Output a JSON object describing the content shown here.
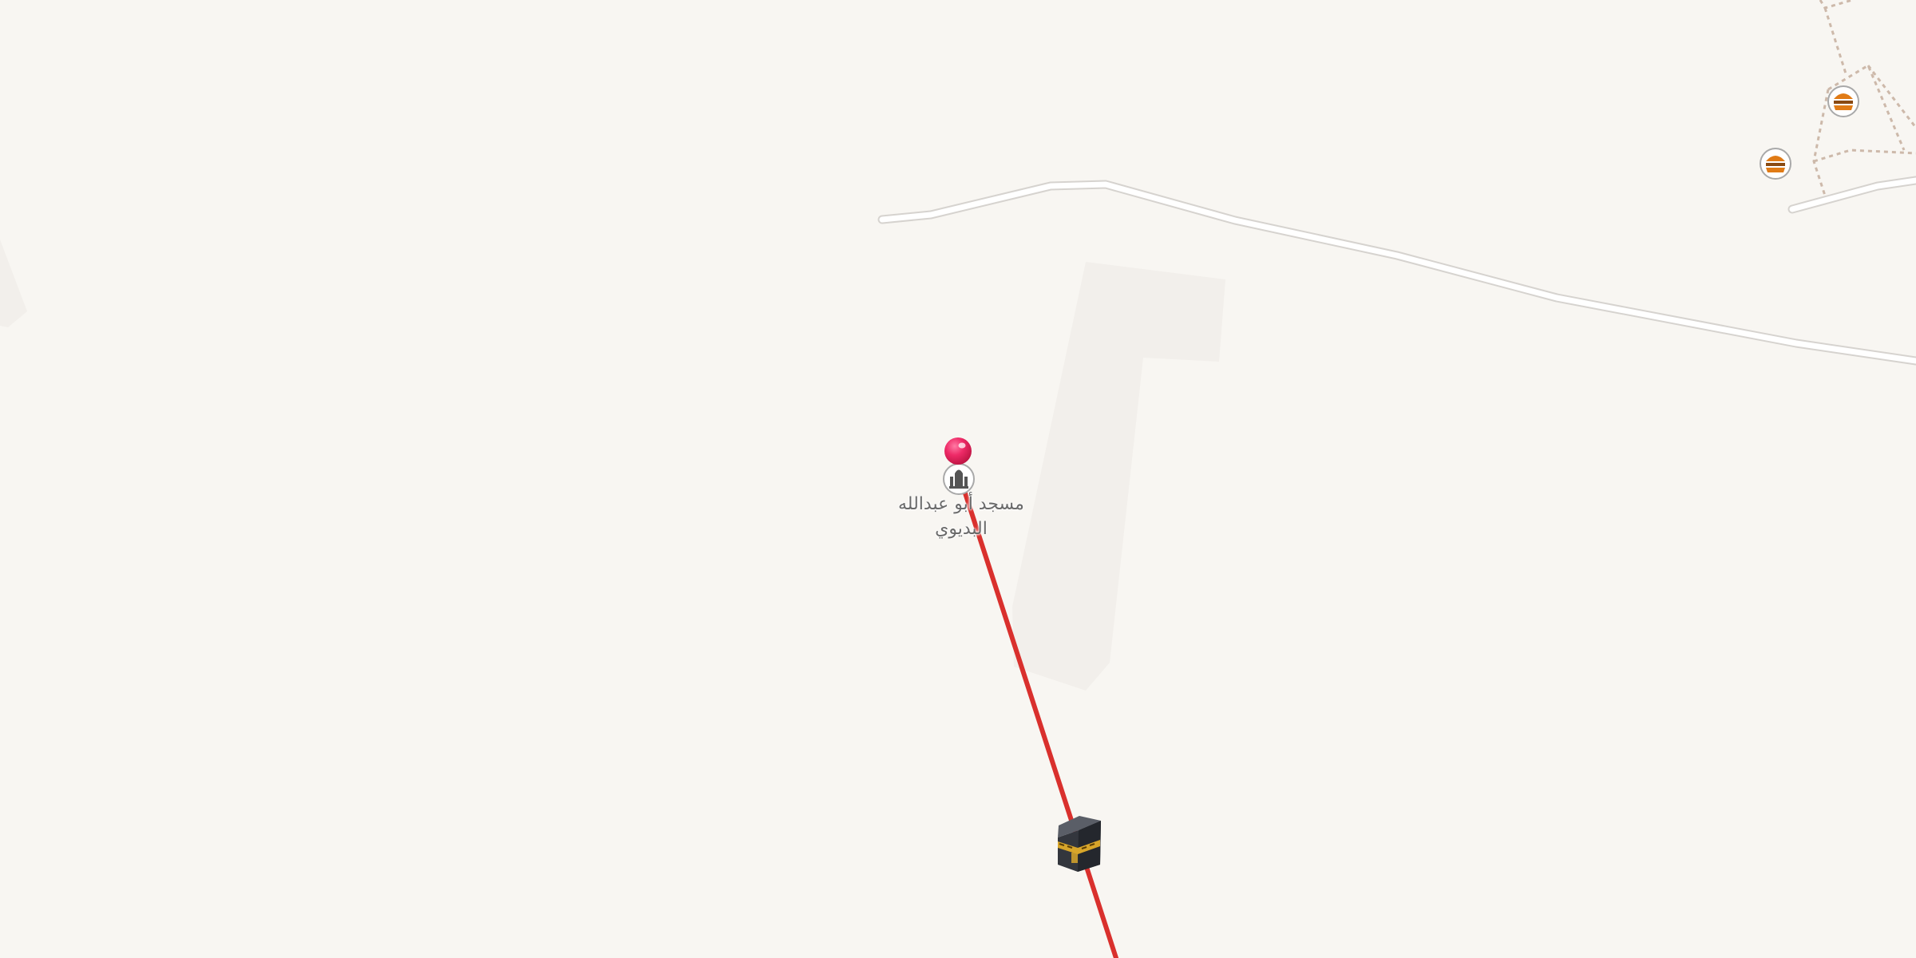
{
  "map": {
    "background_color": "#f8f6f2",
    "road_color": "#ffffff",
    "road_casing_color": "#d6d3cf",
    "path_color": "#cdb9aa",
    "landuse_color": "#f2efeb",
    "route_line_color": "#d9302d",
    "place": {
      "name_line_1": "مسجد أبو عبدالله",
      "name_line_2": "البديوي",
      "icon": "mosque-icon"
    },
    "pin": {
      "icon": "location-pin-icon",
      "color": "#e91e5a"
    },
    "destination": {
      "icon": "kaaba-icon"
    },
    "food_pois": [
      {
        "icon": "burger-icon",
        "color": "#e07b16"
      },
      {
        "icon": "burger-icon",
        "color": "#e07b16"
      }
    ]
  }
}
